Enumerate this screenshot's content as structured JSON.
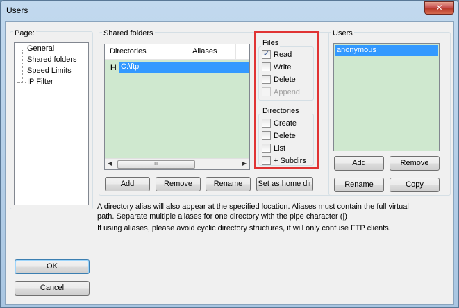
{
  "window": {
    "title": "Users",
    "close_glyph": "✕"
  },
  "page_tree": {
    "label": "Page:",
    "items": [
      "General",
      "Shared folders",
      "Speed Limits",
      "IP Filter"
    ]
  },
  "shared_folders": {
    "label": "Shared folders",
    "columns": [
      "Directories",
      "Aliases"
    ],
    "rows": [
      {
        "flag": "H",
        "directory": "C:\\ftp",
        "alias": ""
      }
    ],
    "scroll_thumb_glyph": "III",
    "buttons": {
      "add": "Add",
      "remove": "Remove",
      "rename": "Rename",
      "set_home": "Set as home dir"
    }
  },
  "files": {
    "label": "Files",
    "read": "Read",
    "write": "Write",
    "delete": "Delete",
    "append": "Append"
  },
  "directories": {
    "label": "Directories",
    "create": "Create",
    "delete": "Delete",
    "list": "List",
    "subdirs": "+ Subdirs"
  },
  "users": {
    "label": "Users",
    "items": [
      "anonymous"
    ],
    "buttons": {
      "add": "Add",
      "remove": "Remove",
      "rename": "Rename",
      "copy": "Copy"
    }
  },
  "info": {
    "line1": "A directory alias will also appear at the specified location. Aliases must contain the full virtual",
    "line2": "path. Separate multiple aliases for one directory with the pipe character (|)",
    "line3": "If using aliases, please avoid cyclic directory structures, it will only confuse FTP clients."
  },
  "dialog": {
    "ok": "OK",
    "cancel": "Cancel"
  },
  "colors": {
    "selection": "#3399ff",
    "list_bg": "#cfe8cf",
    "highlight": "#e03333"
  }
}
